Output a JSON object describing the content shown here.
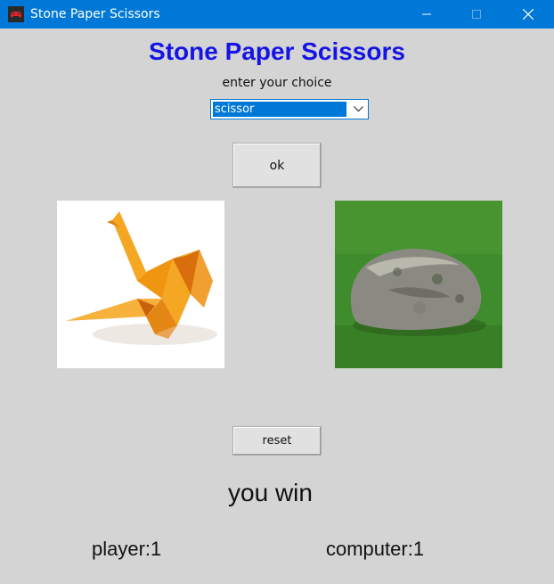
{
  "window": {
    "title": "Stone Paper Scissors",
    "icon": "game-controller-icon",
    "controls": [
      "minimize-icon",
      "maximize-icon",
      "close-icon"
    ]
  },
  "heading": "Stone Paper Scissors",
  "prompt": "enter your choice",
  "choice": {
    "selected": "scissor"
  },
  "buttons": {
    "ok": "ok",
    "reset": "reset"
  },
  "images": {
    "player_choice": "origami-paper-crane-image",
    "computer_choice": "stone-on-grass-image"
  },
  "result": "you win",
  "scores": {
    "player": "player:1",
    "computer": "computer:1"
  },
  "colors": {
    "titlebar": "#0078d7",
    "heading": "#1414e6",
    "background": "#d4d4d4"
  }
}
